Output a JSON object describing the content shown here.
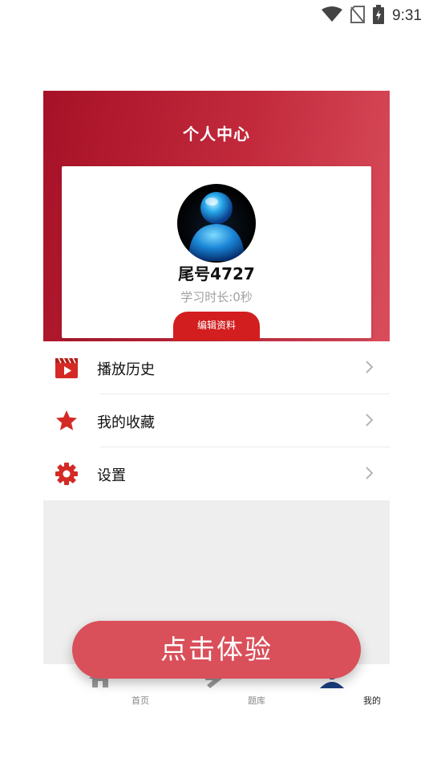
{
  "status_bar": {
    "time": "9:31",
    "icons": [
      "wifi-icon",
      "no-sim-icon",
      "battery-charging-icon"
    ]
  },
  "header": {
    "title": "个人中心"
  },
  "profile": {
    "username": "尾号4727",
    "study_time": "学习时长:0秒",
    "edit_label": "编辑资料",
    "avatar_icon": "user-avatar-icon"
  },
  "menu": {
    "items": [
      {
        "label": "播放历史",
        "icon": "play-history-icon"
      },
      {
        "label": "我的收藏",
        "icon": "star-icon"
      },
      {
        "label": "设置",
        "icon": "gear-icon"
      }
    ]
  },
  "tabbar": {
    "tabs": [
      {
        "label": "首页",
        "icon": "home-icon",
        "active": false
      },
      {
        "label": "题库",
        "icon": "pencil-icon",
        "active": false
      },
      {
        "label": "我的",
        "icon": "user-icon",
        "active": true
      }
    ]
  },
  "cta": {
    "label": "点击体验"
  },
  "colors": {
    "brand_red": "#c22a3c",
    "menu_icon_red": "#d42a25",
    "cta_red": "#d9505a",
    "active_tab_blue": "#1a3e80"
  }
}
